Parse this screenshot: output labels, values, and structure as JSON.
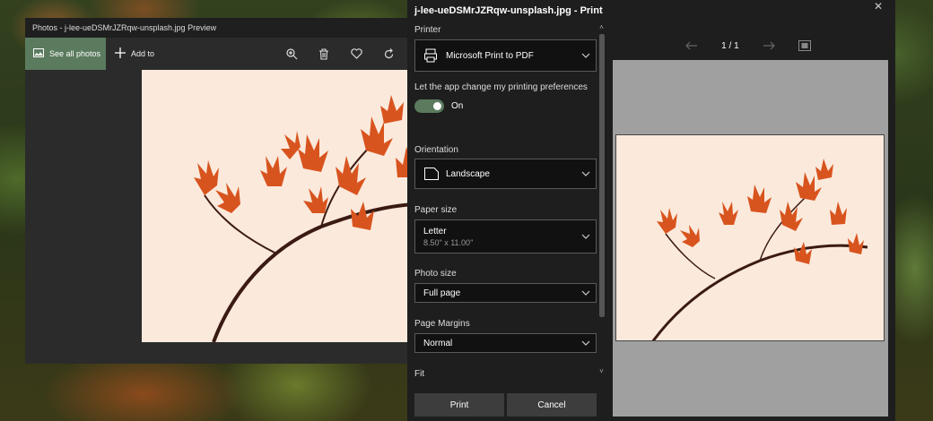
{
  "photos_window": {
    "title": "Photos - j-lee-ueDSMrJZRqw-unsplash.jpg Preview",
    "see_all_label": "See all photos",
    "add_to_label": "Add to",
    "icons": [
      "zoom-in-icon",
      "delete-icon",
      "heart-icon",
      "rotate-icon"
    ]
  },
  "print_dialog": {
    "title": "j-lee-ueDSMrJZRqw-unsplash.jpg - Print",
    "printer_label": "Printer",
    "printer_value": "Microsoft Print to PDF",
    "prefs_label": "Let the app change my printing preferences",
    "prefs_toggle_text": "On",
    "orientation_label": "Orientation",
    "orientation_value": "Landscape",
    "paper_size_label": "Paper size",
    "paper_size_value": "Letter",
    "paper_size_sub": "8.50\" x 11.00\"",
    "photo_size_label": "Photo size",
    "photo_size_value": "Full page",
    "page_margins_label": "Page Margins",
    "page_margins_value": "Normal",
    "fit_label": "Fit",
    "print_button": "Print",
    "cancel_button": "Cancel",
    "preview_page_indicator": "1 / 1"
  },
  "colors": {
    "accent": "#5b7b5e",
    "dialog_bg": "#1e1e1e",
    "photo_bg": "#fbe9dc",
    "leaf": "#d8541e"
  }
}
